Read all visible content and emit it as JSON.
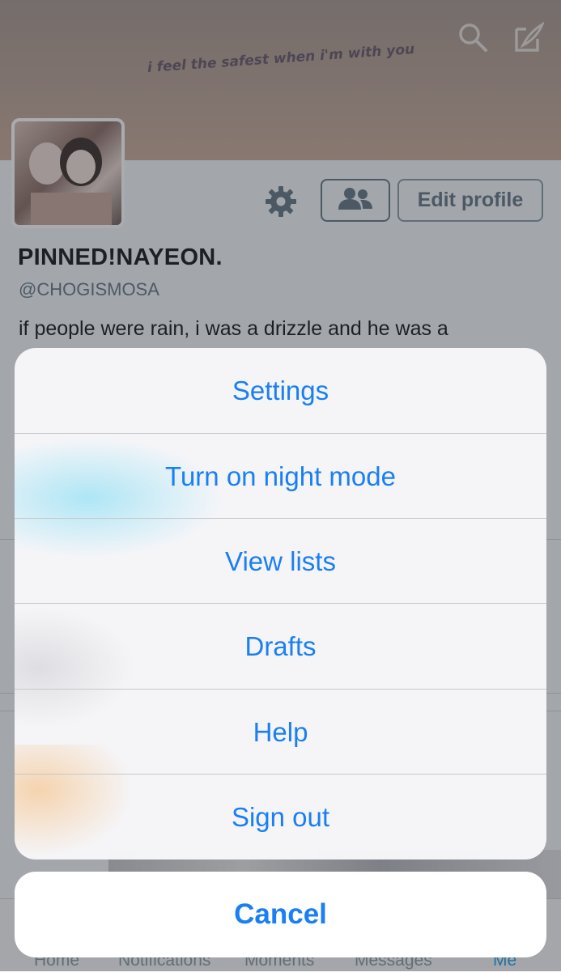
{
  "header": {
    "banner_quote": "i feel the safest when i'm with you",
    "search_icon": "search-icon",
    "compose_icon": "compose-icon"
  },
  "profile": {
    "edit_profile_label": "Edit profile",
    "display_name": "PINNED!NAYEON.",
    "handle": "@CHOGISMOSA",
    "bio": "if people were rain, i was a drizzle and he was a"
  },
  "tabbar": {
    "tabs": [
      {
        "label": "Home",
        "icon": "home-icon"
      },
      {
        "label": "Notifications",
        "icon": "bell-icon"
      },
      {
        "label": "Moments",
        "icon": "lightning-icon"
      },
      {
        "label": "Messages",
        "icon": "envelope-icon"
      },
      {
        "label": "Me",
        "icon": "person-icon"
      }
    ]
  },
  "action_sheet": {
    "items": [
      {
        "label": "Settings"
      },
      {
        "label": "Turn on night mode"
      },
      {
        "label": "View lists"
      },
      {
        "label": "Drafts"
      },
      {
        "label": "Help"
      },
      {
        "label": "Sign out"
      }
    ],
    "cancel_label": "Cancel"
  },
  "colors": {
    "accent": "#1a7ff2",
    "twitter_blue": "#1da1f2"
  }
}
